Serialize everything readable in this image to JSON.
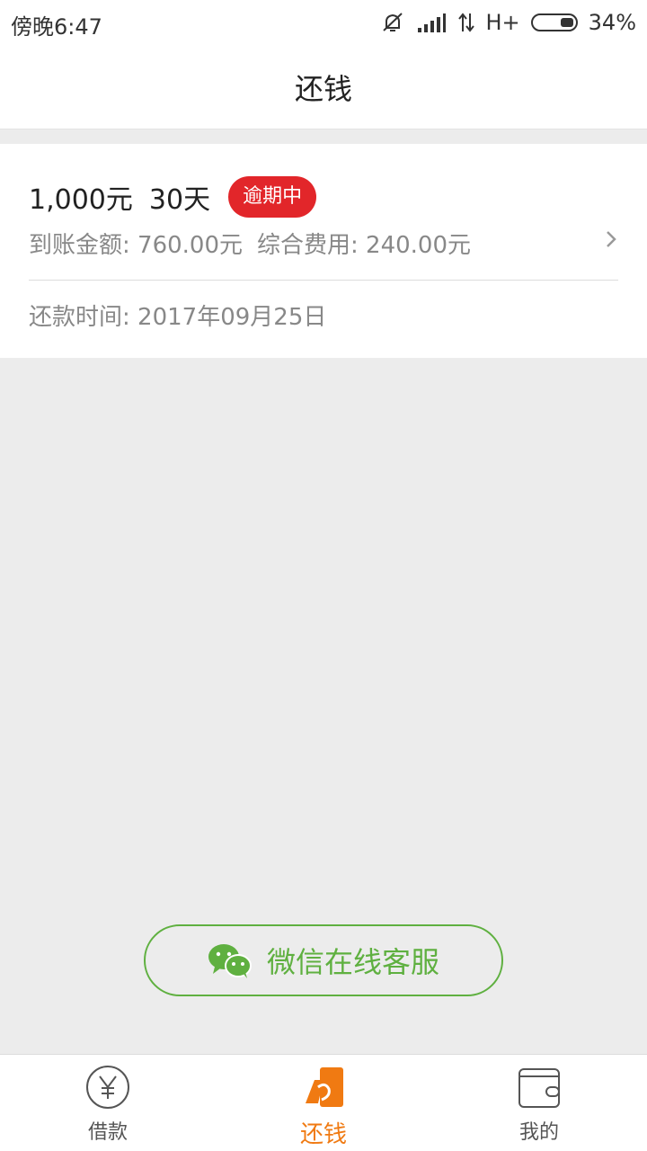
{
  "status_bar": {
    "time": "傍晚6:47",
    "network": "H+",
    "battery": "34%"
  },
  "header": {
    "title": "还钱"
  },
  "loan": {
    "amount": "1,000元",
    "days": "30天",
    "status_badge": "逾期中",
    "received": "到账金额: 760.00元",
    "fee": "综合费用: 240.00元",
    "due_date": "还款时间: 2017年09月25日"
  },
  "service_button": {
    "label": "微信在线客服"
  },
  "tabs": [
    {
      "label": "借款",
      "icon": "yen-icon"
    },
    {
      "label": "还钱",
      "icon": "repay-icon"
    },
    {
      "label": "我的",
      "icon": "wallet-icon"
    }
  ],
  "colors": {
    "badge_red": "#e2262a",
    "active_orange": "#f07a12",
    "wechat_green": "#5fb040"
  }
}
